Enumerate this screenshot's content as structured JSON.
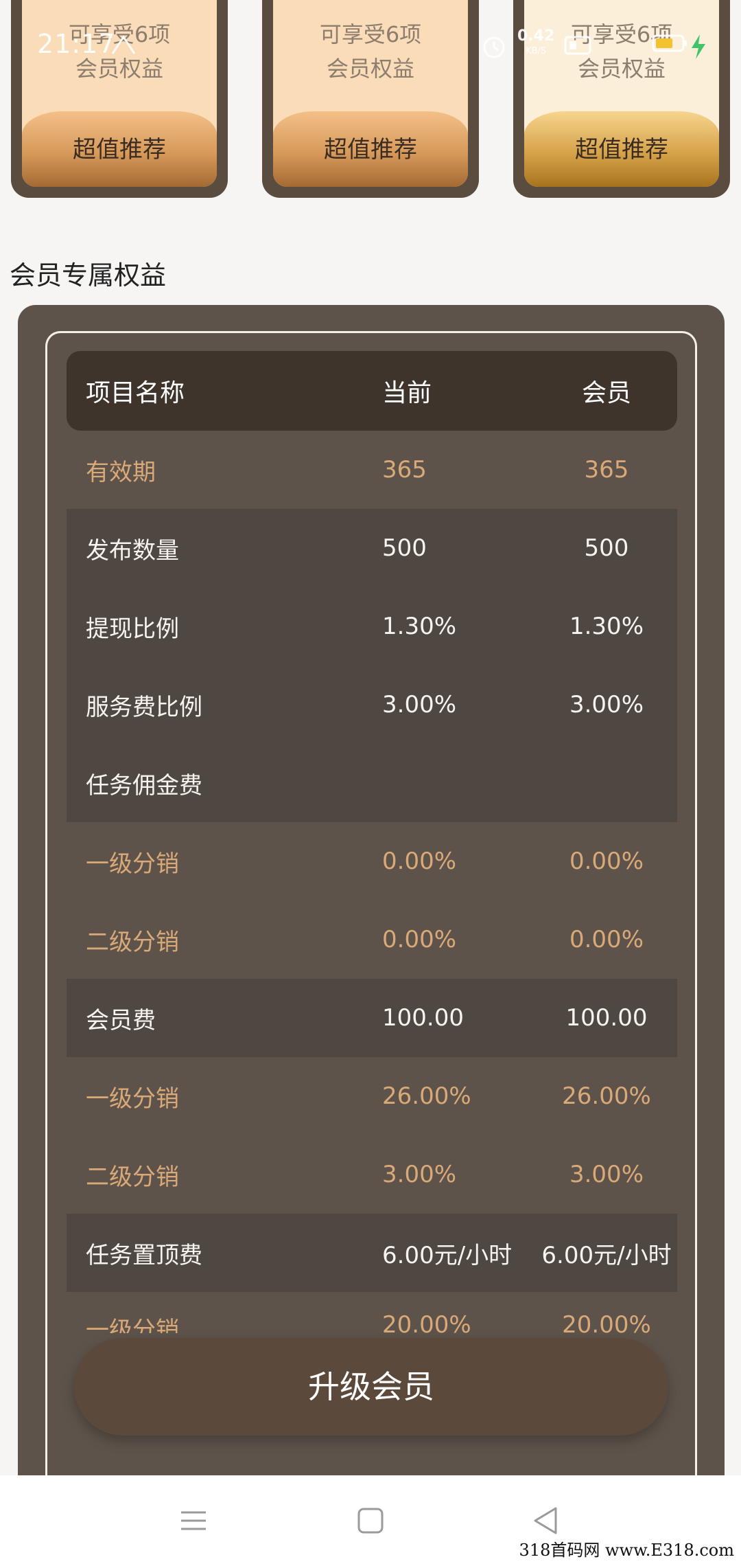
{
  "status_bar": {
    "time": "21:17",
    "net_speed": "0.42",
    "net_unit": "KB/S",
    "icons": [
      "signal-icon",
      "alarm-icon",
      "wifi-icon",
      "battery-icon",
      "charging-icon"
    ]
  },
  "plans": [
    {
      "line1": "可享受6项",
      "line2": "会员权益",
      "cta": "超值推荐"
    },
    {
      "line1": "可享受6项",
      "line2": "会员权益",
      "cta": "超值推荐"
    },
    {
      "line1": "可享受6项",
      "line2": "会员权益",
      "cta": "超值推荐"
    }
  ],
  "section_title": "会员专属权益",
  "table": {
    "headers": {
      "name": "项目名称",
      "current": "当前",
      "member": "会员"
    },
    "rows": [
      {
        "name": "有效期",
        "current": "365",
        "member": "365"
      },
      {
        "name": "发布数量",
        "current": "500",
        "member": "500"
      },
      {
        "name": "提现比例",
        "current": "1.30%",
        "member": "1.30%"
      },
      {
        "name": "服务费比例",
        "current": "3.00%",
        "member": "3.00%"
      },
      {
        "name": "任务佣金费",
        "current": "",
        "member": ""
      },
      {
        "name": "一级分销",
        "current": "0.00%",
        "member": "0.00%"
      },
      {
        "name": "二级分销",
        "current": "0.00%",
        "member": "0.00%"
      },
      {
        "name": "会员费",
        "current": "100.00",
        "member": "100.00"
      },
      {
        "name": "一级分销",
        "current": "26.00%",
        "member": "26.00%"
      },
      {
        "name": "二级分销",
        "current": "3.00%",
        "member": "3.00%"
      },
      {
        "name": "任务置顶费",
        "current": "6.00元/小时",
        "member": "6.00元/小时"
      },
      {
        "name": "一级分销",
        "current": "20.00%",
        "member": "20.00%"
      }
    ]
  },
  "upgrade_button": "升级会员",
  "nav": [
    "menu-icon",
    "home-icon",
    "back-icon"
  ],
  "watermark": "318首码网 www.E318.com",
  "colors": {
    "accent_gold": "#d9a978",
    "panel": "#5d534b",
    "button": "#5b4a3b"
  }
}
